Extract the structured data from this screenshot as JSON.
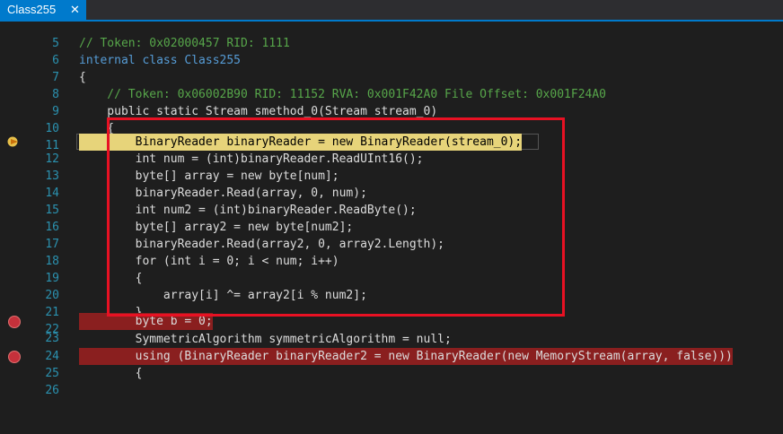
{
  "tab": {
    "title": "Class255",
    "close": "✕"
  },
  "lines": [
    {
      "n": "5",
      "t": ""
    },
    {
      "n": "6",
      "t": "// Token: 0x02000457 RID: 1111"
    },
    {
      "n": "7",
      "t": "internal class Class255"
    },
    {
      "n": "8",
      "t": "{"
    },
    {
      "n": "9",
      "t": "    // Token: 0x06002B90 RID: 11152 RVA: 0x001F42A0 File Offset: 0x001F24A0"
    },
    {
      "n": "10",
      "t": "    public static Stream smethod_0(Stream stream_0)"
    },
    {
      "n": "11",
      "t": "    {"
    },
    {
      "n": "12",
      "t": "        BinaryReader binaryReader = new BinaryReader(stream_0);"
    },
    {
      "n": "13",
      "t": "        int num = (int)binaryReader.ReadUInt16();"
    },
    {
      "n": "14",
      "t": "        byte[] array = new byte[num];"
    },
    {
      "n": "15",
      "t": "        binaryReader.Read(array, 0, num);"
    },
    {
      "n": "16",
      "t": "        int num2 = (int)binaryReader.ReadByte();"
    },
    {
      "n": "17",
      "t": "        byte[] array2 = new byte[num2];"
    },
    {
      "n": "18",
      "t": "        binaryReader.Read(array2, 0, array2.Length);"
    },
    {
      "n": "19",
      "t": "        for (int i = 0; i < num; i++)"
    },
    {
      "n": "20",
      "t": "        {"
    },
    {
      "n": "21",
      "t": "            array[i] ^= array2[i % num2];"
    },
    {
      "n": "22",
      "t": "        }"
    },
    {
      "n": "23",
      "t": "        byte b = 0;"
    },
    {
      "n": "24",
      "t": "        SymmetricAlgorithm symmetricAlgorithm = null;"
    },
    {
      "n": "25",
      "t": "        using (BinaryReader binaryReader2 = new BinaryReader(new MemoryStream(array, false)))"
    },
    {
      "n": "26",
      "t": "        {"
    }
  ],
  "breakpoints": [
    "23",
    "25"
  ],
  "current_line": "12",
  "colors": {
    "accent": "#007acc",
    "highlight_box": "#e81123",
    "current_line": "#e7d47a",
    "breakpoint": "#c5313b"
  }
}
